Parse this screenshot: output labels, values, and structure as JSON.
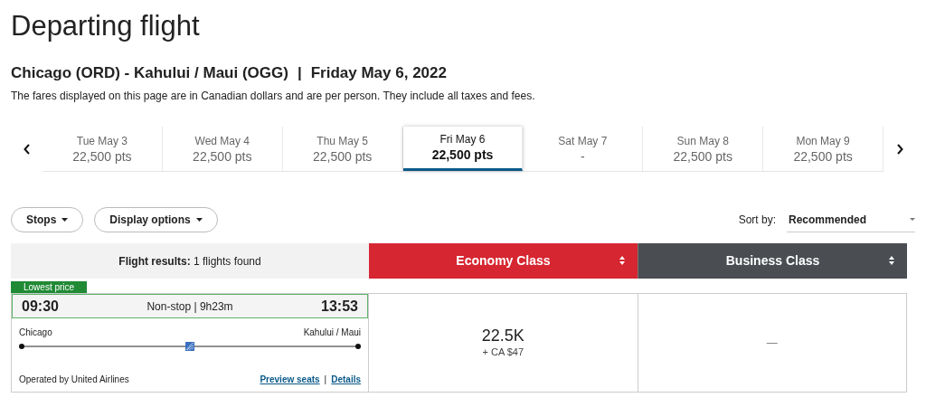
{
  "page_title": "Departing flight",
  "route": {
    "cities": "Chicago (ORD) - Kahului / Maui (OGG)",
    "separator": "|",
    "date": "Friday May 6, 2022"
  },
  "fare_note": "The fares displayed on this page are in Canadian dollars and are per person. They include all taxes and fees.",
  "date_tabs": [
    {
      "day": "Tue May 3",
      "price": "22,500 pts",
      "selected": false
    },
    {
      "day": "Wed May 4",
      "price": "22,500 pts",
      "selected": false
    },
    {
      "day": "Thu May 5",
      "price": "22,500 pts",
      "selected": false
    },
    {
      "day": "Fri May 6",
      "price": "22,500 pts",
      "selected": true
    },
    {
      "day": "Sat May 7",
      "price": "-",
      "selected": false
    },
    {
      "day": "Sun May 8",
      "price": "22,500 pts",
      "selected": false
    },
    {
      "day": "Mon May 9",
      "price": "22,500 pts",
      "selected": false
    }
  ],
  "filters": [
    {
      "label": "Stops"
    },
    {
      "label": "Display options"
    }
  ],
  "sort": {
    "label": "Sort by:",
    "value": "Recommended"
  },
  "results_header": {
    "label": "Flight results:",
    "count": "1 flights found"
  },
  "fare_classes": [
    {
      "label": "Economy Class",
      "selected": true
    },
    {
      "label": "Business Class",
      "selected": false
    }
  ],
  "flights": [
    {
      "badge": "Lowest price",
      "depart": "09:30",
      "summary": "Non-stop | 9h23m",
      "arrive": "13:53",
      "origin": "Chicago",
      "destination": "Kahului / Maui",
      "operator": "Operated by United Airlines",
      "links": [
        "Preview seats",
        "Details"
      ],
      "link_separator": "|",
      "fares": [
        {
          "kind": "price",
          "amount": "22.5K",
          "taxes": "+ CA $47"
        },
        {
          "kind": "none",
          "text": "—"
        }
      ]
    }
  ]
}
